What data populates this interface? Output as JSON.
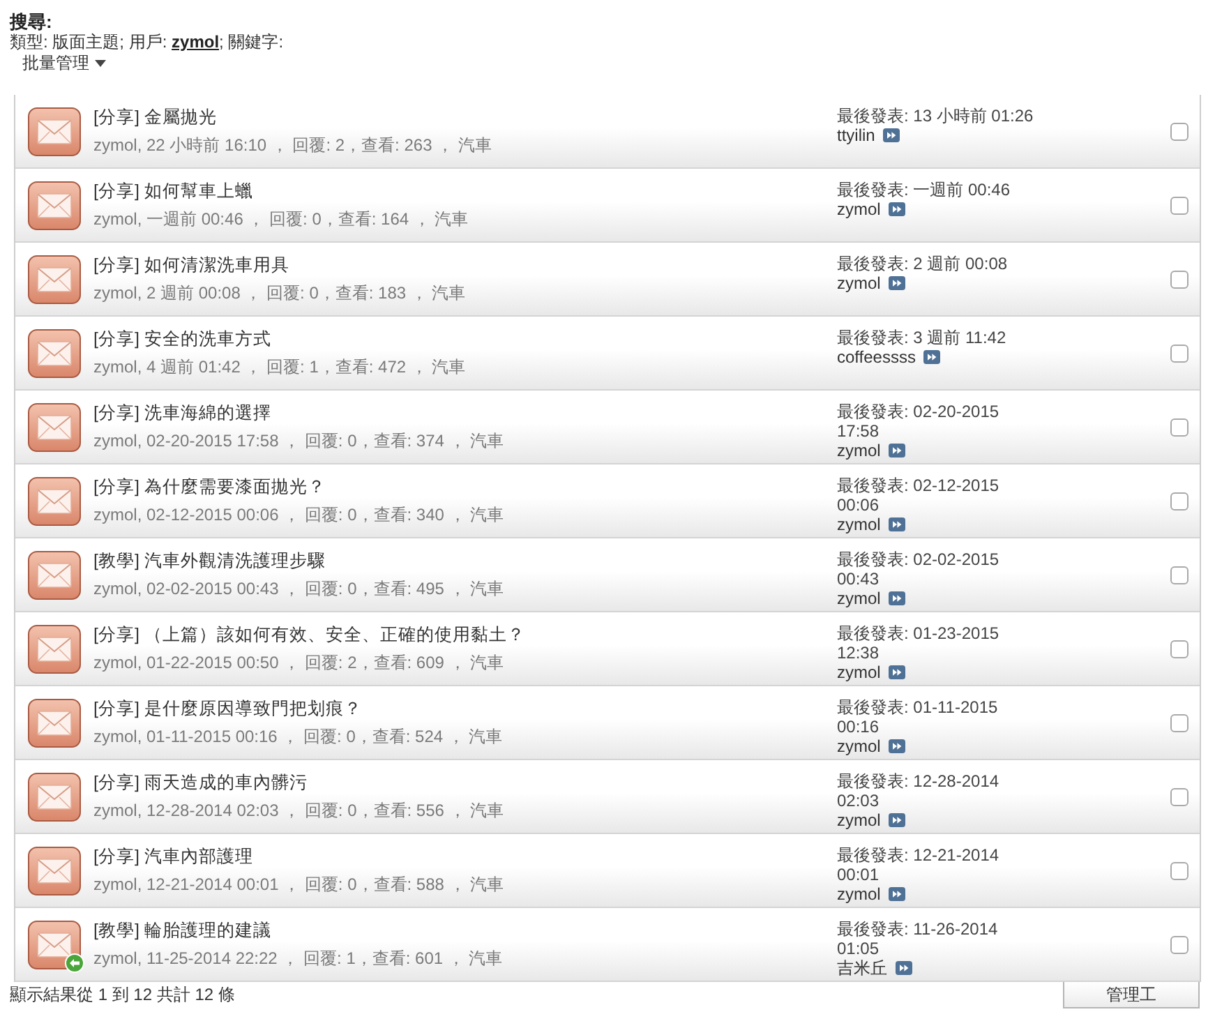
{
  "search": {
    "heading": "搜尋:",
    "criteria_start": "類型: 版面主題; 用戶:",
    "user_link": "zymol",
    "criteria_end": "; 關鍵字:"
  },
  "bulk_menu": {
    "label": "批量管理"
  },
  "threads": [
    {
      "prefix": "[分享]",
      "title": "金屬拋光",
      "meta": "zymol, 22 小時前 16:10 ， 回覆: 2，查看: 263 ， 汽車",
      "last_post": "最後發表: 13 小時前 01:26",
      "last_poster": "ttyilin",
      "badge": false,
      "checked": false
    },
    {
      "prefix": "[分享]",
      "title": "如何幫車上蠟",
      "meta": "zymol, 一週前 00:46 ， 回覆: 0，查看: 164 ， 汽車",
      "last_post": "最後發表: 一週前 00:46",
      "last_poster": "zymol",
      "badge": false,
      "checked": false
    },
    {
      "prefix": "[分享]",
      "title": "如何清潔洗車用具",
      "meta": "zymol, 2 週前 00:08 ， 回覆: 0，查看: 183 ， 汽車",
      "last_post": "最後發表: 2 週前 00:08",
      "last_poster": "zymol",
      "badge": false,
      "checked": false
    },
    {
      "prefix": "[分享]",
      "title": "安全的洗車方式",
      "meta": "zymol, 4 週前 01:42 ， 回覆: 1，查看: 472 ， 汽車",
      "last_post": "最後發表: 3 週前 11:42",
      "last_poster": "coffeessss",
      "badge": false,
      "checked": false
    },
    {
      "prefix": "[分享]",
      "title": "洗車海綿的選擇",
      "meta": "zymol, 02-20-2015 17:58 ， 回覆: 0，查看: 374 ， 汽車",
      "last_post": "最後發表: 02-20-2015 17:58",
      "last_poster": "zymol",
      "badge": false,
      "checked": false
    },
    {
      "prefix": "[分享]",
      "title": "為什麼需要漆面拋光？",
      "meta": "zymol, 02-12-2015 00:06 ， 回覆: 0，查看: 340 ， 汽車",
      "last_post": "最後發表: 02-12-2015 00:06",
      "last_poster": "zymol",
      "badge": false,
      "checked": false
    },
    {
      "prefix": "[教學]",
      "title": "汽車外觀清洗護理步驟",
      "meta": "zymol, 02-02-2015 00:43 ， 回覆: 0，查看: 495 ， 汽車",
      "last_post": "最後發表: 02-02-2015 00:43",
      "last_poster": "zymol",
      "badge": false,
      "checked": false
    },
    {
      "prefix": "[分享]",
      "title": "（上篇）該如何有效、安全、正確的使用黏土？",
      "meta": "zymol, 01-22-2015 00:50 ， 回覆: 2，查看: 609 ， 汽車",
      "last_post": "最後發表: 01-23-2015 12:38",
      "last_poster": "zymol",
      "badge": false,
      "checked": false
    },
    {
      "prefix": "[分享]",
      "title": "是什麼原因導致門把划痕？",
      "meta": "zymol, 01-11-2015 00:16 ， 回覆: 0，查看: 524 ， 汽車",
      "last_post": "最後發表: 01-11-2015 00:16",
      "last_poster": "zymol",
      "badge": false,
      "checked": false
    },
    {
      "prefix": "[分享]",
      "title": "雨天造成的車內髒污",
      "meta": "zymol, 12-28-2014 02:03 ， 回覆: 0，查看: 556 ， 汽車",
      "last_post": "最後發表: 12-28-2014 02:03",
      "last_poster": "zymol",
      "badge": false,
      "checked": false
    },
    {
      "prefix": "[分享]",
      "title": "汽車內部護理",
      "meta": "zymol, 12-21-2014 00:01 ， 回覆: 0，查看: 588 ， 汽車",
      "last_post": "最後發表: 12-21-2014 00:01",
      "last_poster": "zymol",
      "badge": false,
      "checked": false
    },
    {
      "prefix": "[教學]",
      "title": "輪胎護理的建議",
      "meta": "zymol, 11-25-2014 22:22 ， 回覆: 1，查看: 601 ， 汽車",
      "last_post": "最後發表: 11-26-2014 01:05",
      "last_poster": "吉米丘",
      "badge": true,
      "checked": false
    }
  ],
  "footer": {
    "results": "顯示結果從 1 到 12 共計 12 條",
    "button": "管理工"
  }
}
